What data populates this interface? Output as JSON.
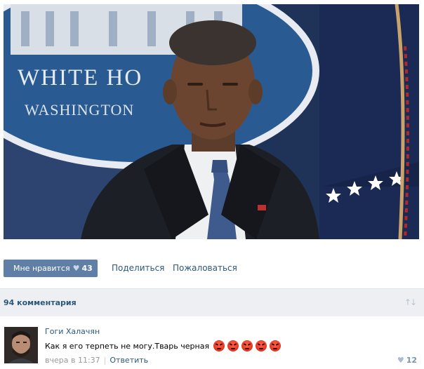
{
  "post": {
    "photo_sign_text_line1": "WHITE HO",
    "photo_sign_text_line2": "WASHINGTON"
  },
  "actions": {
    "like_label": "Мне нравится",
    "like_count": "43",
    "share_label": "Поделиться",
    "report_label": "Пожаловаться"
  },
  "comments_header": {
    "count_label": "94 комментария",
    "sort_icon": "sort-arrows-icon"
  },
  "comment": {
    "author": "Гоги Халачян",
    "text": "Как я его терпеть не могу.Тварь черная",
    "emoji_icon": "angry-face-icon",
    "emoji_count": 5,
    "time": "вчера в 11:37",
    "reply_label": "Ответить",
    "likes": "12"
  },
  "colors": {
    "link": "#2b587a",
    "like_button": "#5f7fa6",
    "comments_bar": "#edeff2"
  }
}
